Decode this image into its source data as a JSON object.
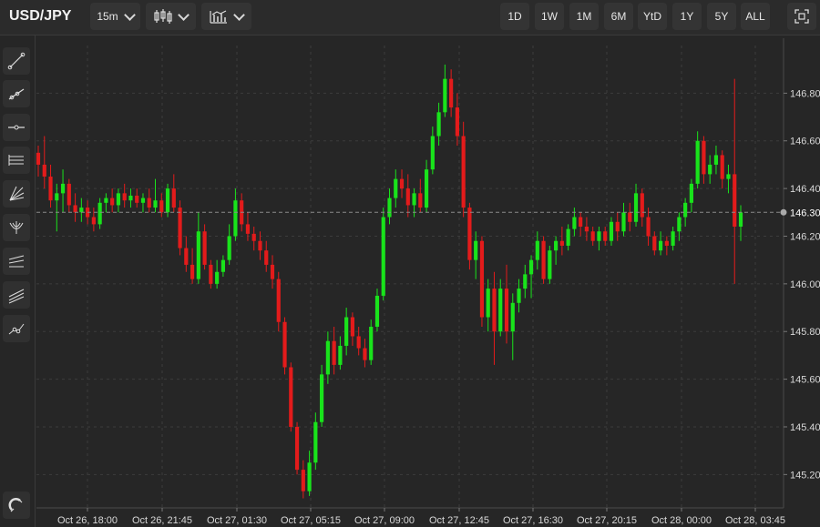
{
  "header": {
    "symbol": "USD/JPY",
    "interval": "15m",
    "chart_type_icon": "candlestick-icon",
    "indicators_icon": "indicators-icon",
    "ranges": [
      "1D",
      "1W",
      "1M",
      "6M",
      "YtD",
      "1Y",
      "5Y",
      "ALL"
    ],
    "fullscreen_icon": "fullscreen-icon"
  },
  "tools": [
    "trend-line-icon",
    "ray-icon",
    "horizontal-line-icon",
    "parallel-channel-icon",
    "fan-icon",
    "pitchfork-icon",
    "regression-icon",
    "channel-lines-icon",
    "path-icon"
  ],
  "bottom_tool": "magnet-icon",
  "colors": {
    "up": "#19e31b",
    "down": "#e31b1b",
    "bg": "#262626",
    "grid": "#3c3c3c"
  },
  "chart_data": {
    "type": "candlestick",
    "title": "",
    "xlabel": "",
    "ylabel": "",
    "ylim": [
      145.06,
      147.0
    ],
    "last_price": "146.30",
    "y_ticks": [
      "145.20",
      "145.40",
      "145.60",
      "145.80",
      "146.00",
      "146.20",
      "146.40",
      "146.60",
      "146.80"
    ],
    "x_ticks": [
      "Oct 26, 18:00",
      "Oct 26, 21:45",
      "Oct 27, 01:30",
      "Oct 27, 05:15",
      "Oct 27, 09:00",
      "Oct 27, 12:45",
      "Oct 27, 16:30",
      "Oct 27, 20:15",
      "Oct 28, 00:00",
      "Oct 28, 03:45"
    ],
    "candles": [
      [
        146.55,
        146.58,
        146.45,
        146.5
      ],
      [
        146.5,
        146.62,
        146.4,
        146.45
      ],
      [
        146.45,
        146.5,
        146.32,
        146.35
      ],
      [
        146.35,
        146.42,
        146.22,
        146.38
      ],
      [
        146.38,
        146.48,
        146.3,
        146.42
      ],
      [
        146.42,
        146.44,
        146.3,
        146.33
      ],
      [
        146.33,
        146.38,
        146.26,
        146.3
      ],
      [
        146.3,
        146.36,
        146.26,
        146.32
      ],
      [
        146.32,
        146.35,
        146.25,
        146.28
      ],
      [
        146.28,
        146.32,
        146.22,
        146.25
      ],
      [
        146.25,
        146.36,
        146.23,
        146.34
      ],
      [
        146.34,
        146.38,
        146.3,
        146.36
      ],
      [
        146.36,
        146.4,
        146.3,
        146.33
      ],
      [
        146.33,
        146.4,
        146.3,
        146.38
      ],
      [
        146.38,
        146.42,
        146.32,
        146.35
      ],
      [
        146.35,
        146.4,
        146.32,
        146.37
      ],
      [
        146.37,
        146.4,
        146.32,
        146.34
      ],
      [
        146.34,
        146.38,
        146.3,
        146.36
      ],
      [
        146.36,
        146.4,
        146.3,
        146.32
      ],
      [
        146.32,
        146.44,
        146.3,
        146.35
      ],
      [
        146.35,
        146.38,
        146.28,
        146.3
      ],
      [
        146.3,
        146.42,
        146.28,
        146.4
      ],
      [
        146.4,
        146.46,
        146.3,
        146.32
      ],
      [
        146.32,
        146.35,
        146.12,
        146.15
      ],
      [
        146.15,
        146.2,
        146.05,
        146.08
      ],
      [
        146.08,
        146.15,
        146.0,
        146.02
      ],
      [
        146.02,
        146.3,
        146.0,
        146.22
      ],
      [
        146.22,
        146.25,
        146.06,
        146.08
      ],
      [
        146.08,
        146.1,
        145.98,
        146.0
      ],
      [
        146.0,
        146.1,
        145.98,
        146.05
      ],
      [
        146.05,
        146.12,
        146.03,
        146.1
      ],
      [
        146.1,
        146.25,
        146.08,
        146.2
      ],
      [
        146.2,
        146.4,
        146.18,
        146.35
      ],
      [
        146.35,
        146.38,
        146.22,
        146.25
      ],
      [
        146.25,
        146.3,
        146.18,
        146.21
      ],
      [
        146.21,
        146.24,
        146.14,
        146.18
      ],
      [
        146.18,
        146.22,
        146.1,
        146.14
      ],
      [
        146.14,
        146.18,
        146.05,
        146.08
      ],
      [
        146.08,
        146.12,
        145.98,
        146.02
      ],
      [
        146.02,
        146.05,
        145.8,
        145.84
      ],
      [
        145.84,
        145.86,
        145.62,
        145.65
      ],
      [
        145.65,
        145.67,
        145.38,
        145.4
      ],
      [
        145.4,
        145.42,
        145.2,
        145.22
      ],
      [
        145.22,
        145.26,
        145.1,
        145.13
      ],
      [
        145.13,
        145.3,
        145.11,
        145.25
      ],
      [
        145.25,
        145.46,
        145.22,
        145.42
      ],
      [
        145.42,
        145.66,
        145.4,
        145.62
      ],
      [
        145.62,
        145.8,
        145.58,
        145.76
      ],
      [
        145.76,
        145.82,
        145.62,
        145.66
      ],
      [
        145.66,
        145.78,
        145.64,
        145.74
      ],
      [
        145.74,
        145.9,
        145.7,
        145.86
      ],
      [
        145.86,
        145.88,
        145.74,
        145.78
      ],
      [
        145.78,
        145.82,
        145.7,
        145.73
      ],
      [
        145.73,
        145.77,
        145.65,
        145.68
      ],
      [
        145.68,
        145.85,
        145.66,
        145.82
      ],
      [
        145.82,
        145.98,
        145.8,
        145.95
      ],
      [
        145.95,
        146.32,
        145.93,
        146.28
      ],
      [
        146.28,
        146.4,
        146.25,
        146.36
      ],
      [
        146.36,
        146.48,
        146.32,
        146.44
      ],
      [
        146.44,
        146.48,
        146.36,
        146.4
      ],
      [
        146.4,
        146.46,
        146.28,
        146.33
      ],
      [
        146.33,
        146.4,
        146.28,
        146.38
      ],
      [
        146.38,
        146.44,
        146.3,
        146.32
      ],
      [
        146.32,
        146.52,
        146.3,
        146.48
      ],
      [
        146.48,
        146.66,
        146.46,
        146.62
      ],
      [
        146.62,
        146.76,
        146.58,
        146.72
      ],
      [
        146.72,
        146.92,
        146.7,
        146.86
      ],
      [
        146.86,
        146.9,
        146.7,
        146.74
      ],
      [
        146.74,
        146.8,
        146.58,
        146.62
      ],
      [
        146.62,
        146.68,
        146.28,
        146.32
      ],
      [
        146.32,
        146.34,
        146.06,
        146.1
      ],
      [
        146.1,
        146.22,
        146.02,
        146.18
      ],
      [
        146.18,
        146.2,
        145.82,
        145.86
      ],
      [
        145.86,
        146.02,
        145.8,
        145.98
      ],
      [
        145.98,
        146.05,
        145.66,
        145.8
      ],
      [
        145.8,
        146.02,
        145.78,
        145.98
      ],
      [
        145.98,
        146.08,
        145.75,
        145.8
      ],
      [
        145.8,
        145.96,
        145.68,
        145.92
      ],
      [
        145.92,
        146.02,
        145.88,
        145.98
      ],
      [
        145.98,
        146.08,
        145.94,
        146.04
      ],
      [
        146.04,
        146.12,
        145.94,
        146.1
      ],
      [
        146.1,
        146.22,
        146.06,
        146.18
      ],
      [
        146.18,
        146.2,
        146.0,
        146.02
      ],
      [
        146.02,
        146.16,
        146.0,
        146.14
      ],
      [
        146.14,
        146.2,
        146.08,
        146.18
      ],
      [
        146.18,
        146.24,
        146.12,
        146.16
      ],
      [
        146.16,
        146.25,
        146.14,
        146.23
      ],
      [
        146.23,
        146.32,
        146.2,
        146.28
      ],
      [
        146.28,
        146.3,
        146.2,
        146.24
      ],
      [
        146.24,
        146.28,
        146.18,
        146.22
      ],
      [
        146.22,
        146.24,
        146.16,
        146.18
      ],
      [
        146.18,
        146.24,
        146.14,
        146.22
      ],
      [
        146.22,
        146.24,
        146.16,
        146.18
      ],
      [
        146.18,
        146.28,
        146.16,
        146.26
      ],
      [
        146.26,
        146.3,
        146.18,
        146.22
      ],
      [
        146.22,
        146.34,
        146.2,
        146.3
      ],
      [
        146.3,
        146.34,
        146.22,
        146.26
      ],
      [
        146.26,
        146.42,
        146.24,
        146.38
      ],
      [
        146.38,
        146.4,
        146.24,
        146.28
      ],
      [
        146.28,
        146.32,
        146.16,
        146.2
      ],
      [
        146.2,
        146.22,
        146.12,
        146.14
      ],
      [
        146.14,
        146.22,
        146.12,
        146.18
      ],
      [
        146.18,
        146.2,
        146.12,
        146.16
      ],
      [
        146.16,
        146.24,
        146.14,
        146.22
      ],
      [
        146.22,
        146.3,
        146.18,
        146.28
      ],
      [
        146.28,
        146.36,
        146.24,
        146.34
      ],
      [
        146.34,
        146.44,
        146.3,
        146.42
      ],
      [
        146.42,
        146.64,
        146.4,
        146.6
      ],
      [
        146.6,
        146.62,
        146.42,
        146.46
      ],
      [
        146.46,
        146.54,
        146.42,
        146.5
      ],
      [
        146.5,
        146.58,
        146.46,
        146.54
      ],
      [
        146.54,
        146.56,
        146.4,
        146.44
      ],
      [
        146.44,
        146.5,
        146.38,
        146.46
      ],
      [
        146.46,
        146.86,
        146.0,
        146.24
      ],
      [
        146.24,
        146.33,
        146.18,
        146.3
      ]
    ]
  }
}
